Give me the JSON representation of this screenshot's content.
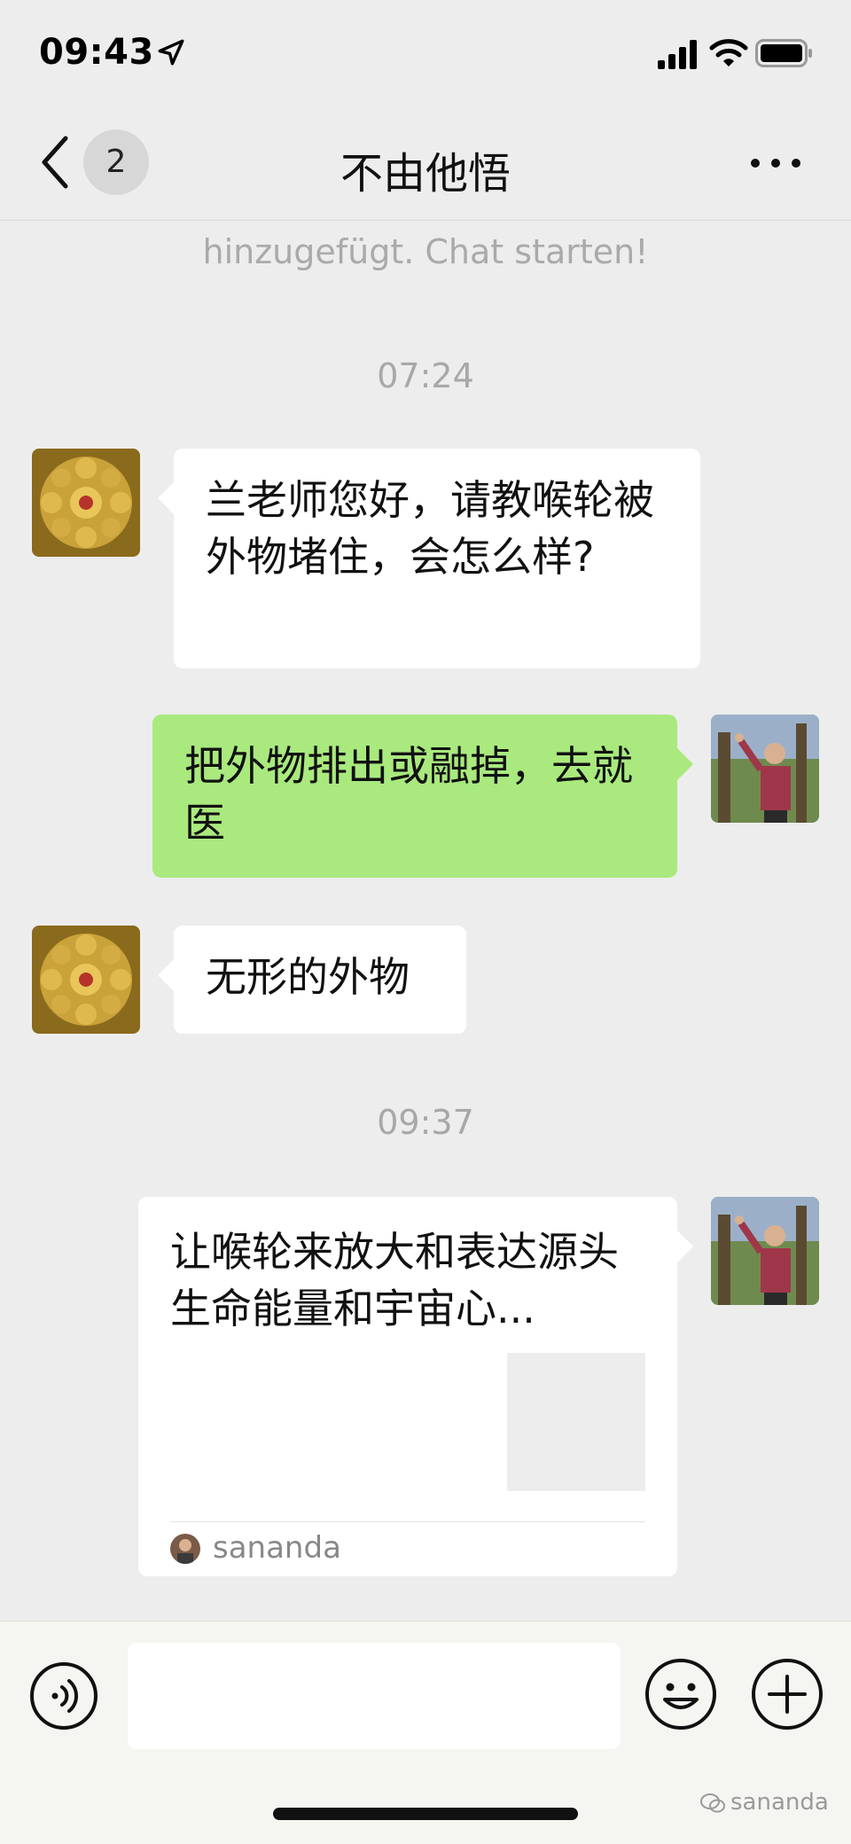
{
  "status_bar": {
    "time": "09:43"
  },
  "nav": {
    "back_badge": "2",
    "title": "不由他悟"
  },
  "system_message": "hinzugefügt. Chat starten!",
  "timestamps": [
    "07:24",
    "09:37"
  ],
  "messages": [
    {
      "side": "in",
      "text": "兰老师您好，请教喉轮被外物堵住，会怎么样?"
    },
    {
      "side": "out",
      "text": "把外物排出或融掉，去就医"
    },
    {
      "side": "in",
      "text": "无形的外物"
    }
  ],
  "card": {
    "title": "让喉轮来放大和表达源头生命能量和宇宙心...",
    "source": "sananda"
  },
  "watermark": "sananda",
  "colors": {
    "background": "#ededed",
    "bubble_out": "#a9e97e",
    "bubble_in": "#ffffff"
  },
  "icons": [
    "location-arrow-icon",
    "signal-icon",
    "wifi-icon",
    "battery-icon",
    "back-icon",
    "more-icon",
    "voice-icon",
    "emoji-icon",
    "plus-icon"
  ]
}
